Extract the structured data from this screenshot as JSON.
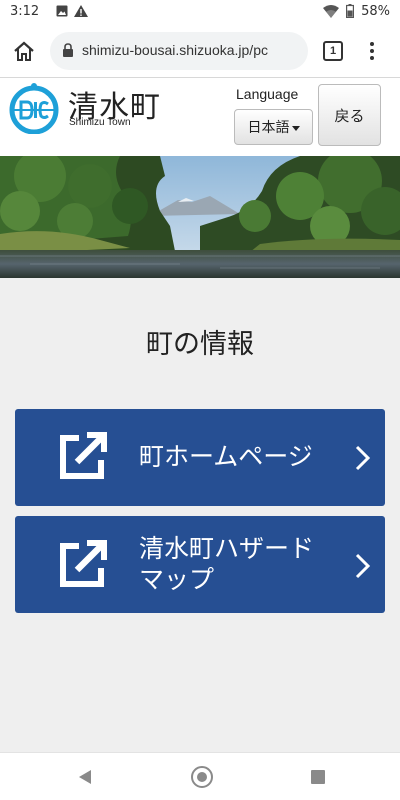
{
  "status_bar": {
    "time": "3:12",
    "battery": "58%",
    "icons": [
      "image-notification-icon",
      "warning-icon",
      "wifi-icon",
      "battery-icon"
    ]
  },
  "browser": {
    "url": "shimizu-bousai.shizuoka.jp/pc",
    "tab_count": "1",
    "icons": [
      "home-icon",
      "lock-icon",
      "tabs-icon",
      "more-menu-icon"
    ]
  },
  "header": {
    "logo_title": "清水町",
    "logo_subtitle": "Shimizu Town",
    "language_label": "Language",
    "language_selected": "日本語",
    "back_label": "戻る"
  },
  "main": {
    "section_title": "町の情報",
    "links": [
      {
        "label": "町ホームページ"
      },
      {
        "label_line1": "清水町ハザード",
        "label_line2": "マップ"
      }
    ]
  },
  "colors": {
    "button_blue": "#264f93",
    "logo_blue": "#1ea0d8",
    "page_bg": "#efefef"
  }
}
